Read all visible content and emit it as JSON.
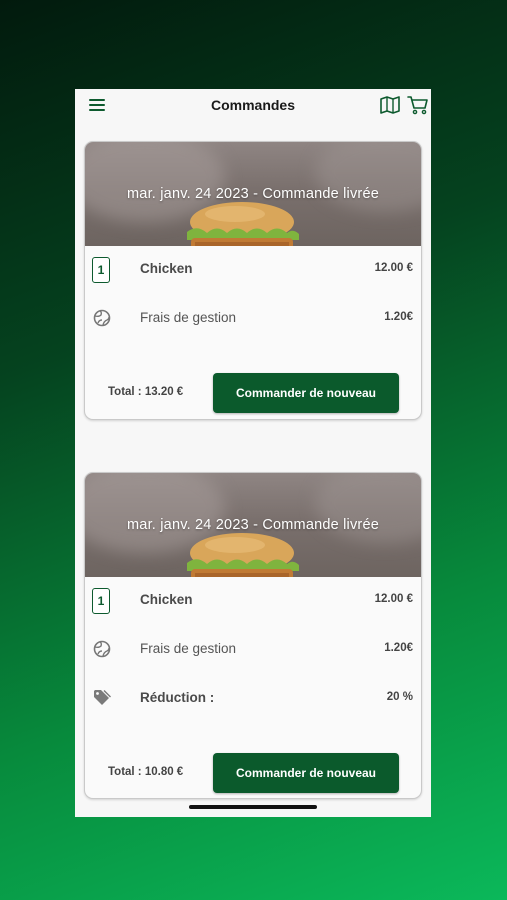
{
  "header": {
    "title": "Commandes",
    "menu_icon": "menu-icon",
    "map_icon": "map-icon",
    "cart_icon": "cart-icon"
  },
  "colors": {
    "brand_green": "#0b5a2c",
    "card_background": "#fafafa"
  },
  "orders": [
    {
      "banner_title": "mar. janv. 24 2023 - Commande livrée",
      "items": [
        {
          "kind": "product",
          "qty": "1",
          "name": "Chicken",
          "price": "12.00 €"
        },
        {
          "kind": "fee",
          "icon": "globe-icon",
          "name": "Frais de gestion",
          "price": "1.20€"
        }
      ],
      "total": "Total : 13.20 €",
      "reorder_label": "Commander de nouveau"
    },
    {
      "banner_title": "mar. janv. 24 2023 - Commande livrée",
      "items": [
        {
          "kind": "product",
          "qty": "1",
          "name": "Chicken",
          "price": "12.00 €"
        },
        {
          "kind": "fee",
          "icon": "globe-icon",
          "name": "Frais de gestion",
          "price": "1.20€"
        },
        {
          "kind": "discount",
          "icon": "tag-icon",
          "name": "Réduction :",
          "price": "20 %"
        }
      ],
      "total": "Total : 10.80 €",
      "reorder_label": "Commander de nouveau"
    }
  ]
}
